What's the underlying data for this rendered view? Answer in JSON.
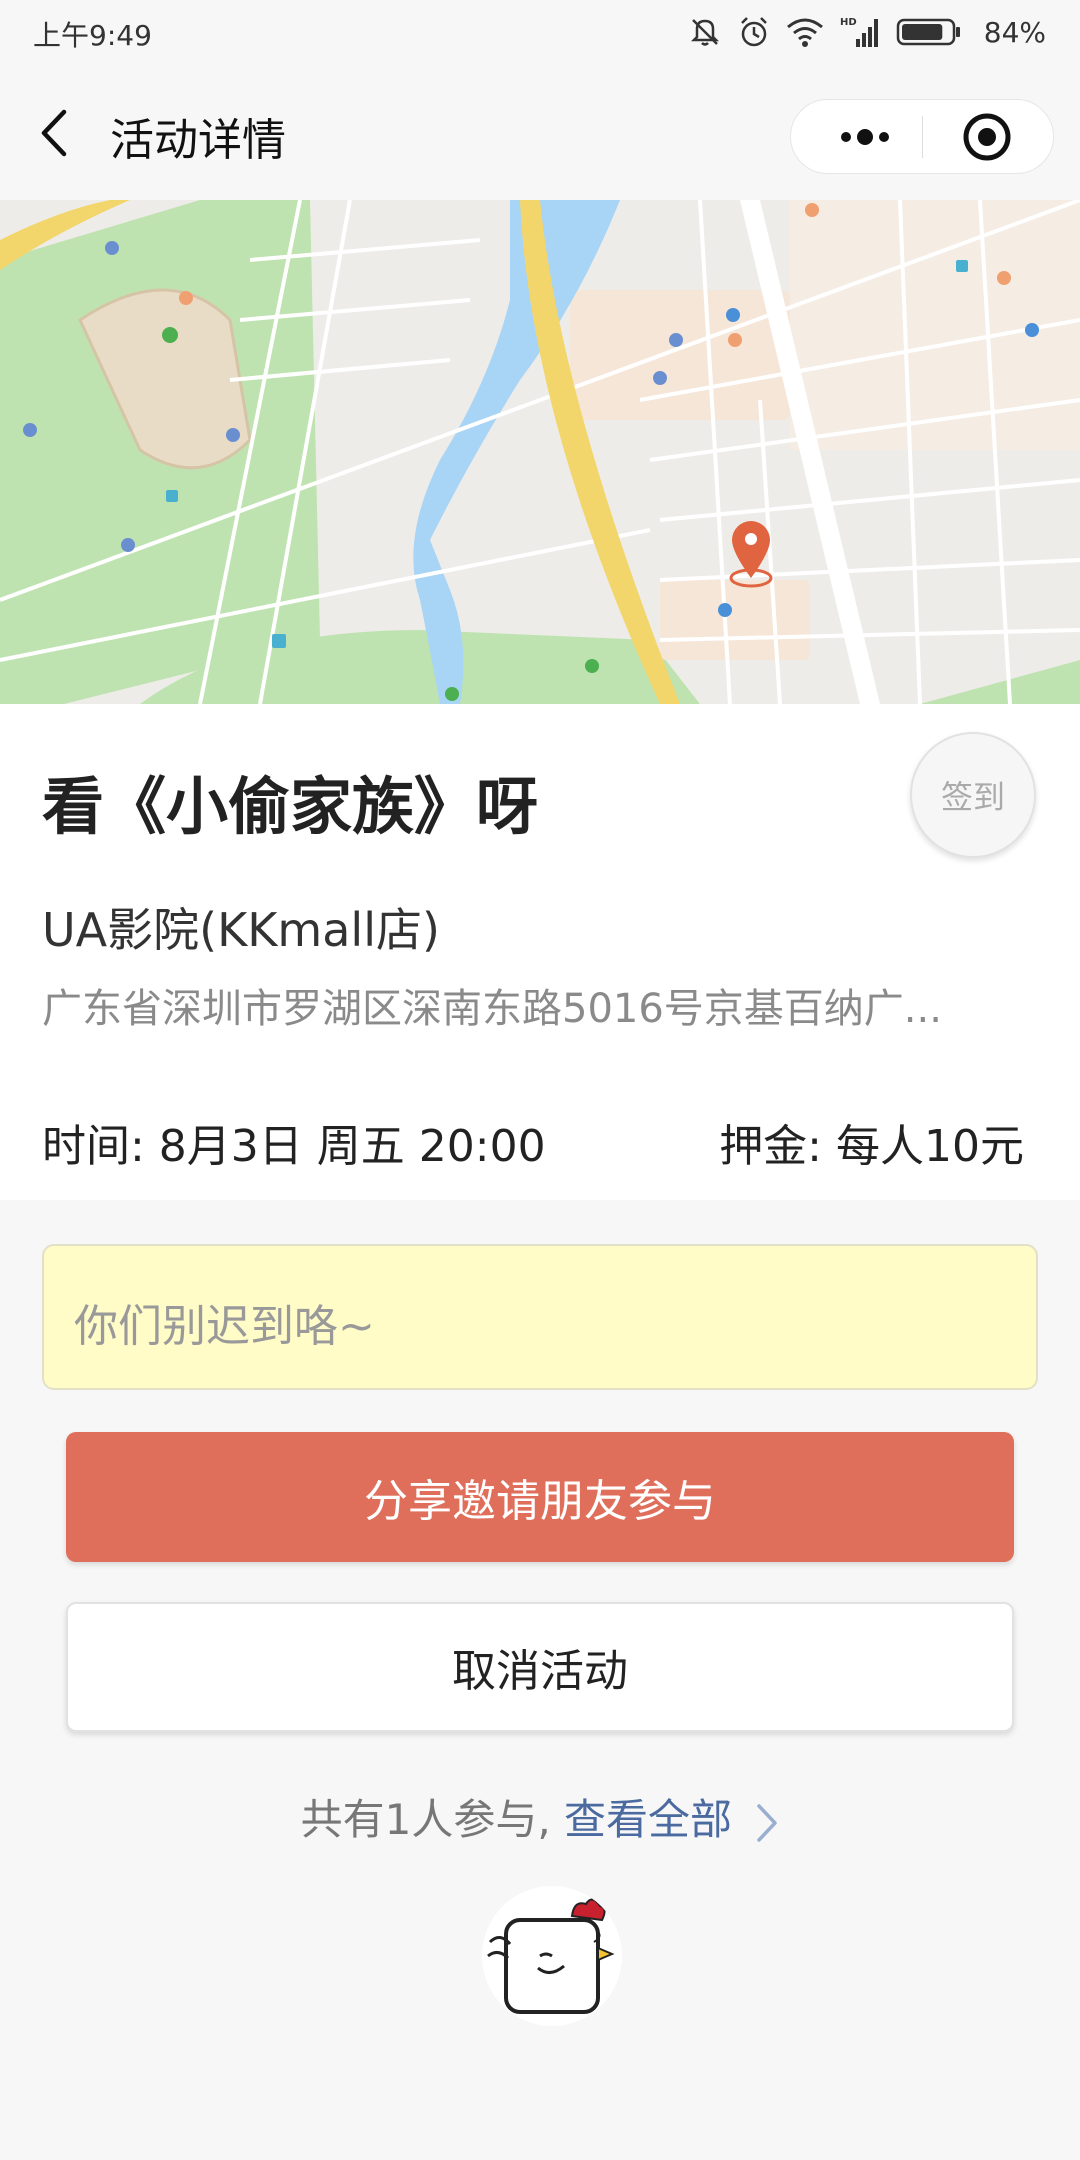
{
  "status_bar": {
    "time": "上午9:49",
    "battery_percent": "84%",
    "battery_level": 0.84,
    "icons": [
      "mute-icon",
      "alarm-icon",
      "wifi-icon",
      "hd-signal-icon",
      "battery-icon"
    ]
  },
  "nav": {
    "title": "活动详情",
    "back_icon": "chevron-left-icon",
    "more_icon": "more-dots-icon",
    "close_icon": "target-close-icon"
  },
  "map": {
    "marker_icon": "location-pin-icon",
    "colors": {
      "park": "#bfe3b0",
      "water": "#a8d4f5",
      "highway": "#f2d66b",
      "marker": "#e0643f"
    }
  },
  "event": {
    "title": "看《小偷家族》呀",
    "checkin_label": "签到",
    "venue": "UA影院(KKmall店)",
    "address": "广东省深圳市罗湖区深南东路5016号京基百纳广...",
    "time": "时间: 8月3日 周五 20:00",
    "deposit": "押金: 每人10元"
  },
  "note": {
    "text": "你们别迟到咯~"
  },
  "actions": {
    "share_label": "分享邀请朋友参与",
    "cancel_label": "取消活动"
  },
  "participants": {
    "summary": "共有1人参与,",
    "view_all": "查看全部",
    "arrow_icon": "chevron-right-icon",
    "avatar_icon": "chicken-avatar-icon"
  },
  "colors": {
    "accent": "#df6f5b",
    "link": "#4a6aa0",
    "note_bg": "#fffcc8"
  }
}
